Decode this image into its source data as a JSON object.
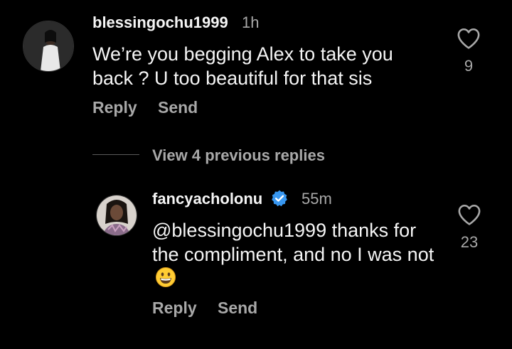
{
  "comment": {
    "username": "blessingochu1999",
    "time": "1h",
    "text": "We’re you begging Alex to take you back ? U too beautiful for that sis",
    "likes": "9",
    "reply_label": "Reply",
    "send_label": "Send"
  },
  "view_replies_label": "View 4 previous replies",
  "reply": {
    "username": "fancyacholonu",
    "verified": true,
    "time": "55m",
    "text": "@blessingochu1999 thanks for the compliment, and no I was not",
    "emoji": "grinning-face-emoji",
    "likes": "23",
    "reply_label": "Reply",
    "send_label": "Send"
  },
  "colors": {
    "background": "#000000",
    "primary_text": "#f5f5f5",
    "secondary_text": "#a8a8a8",
    "verified_badge": "#3897f0"
  }
}
